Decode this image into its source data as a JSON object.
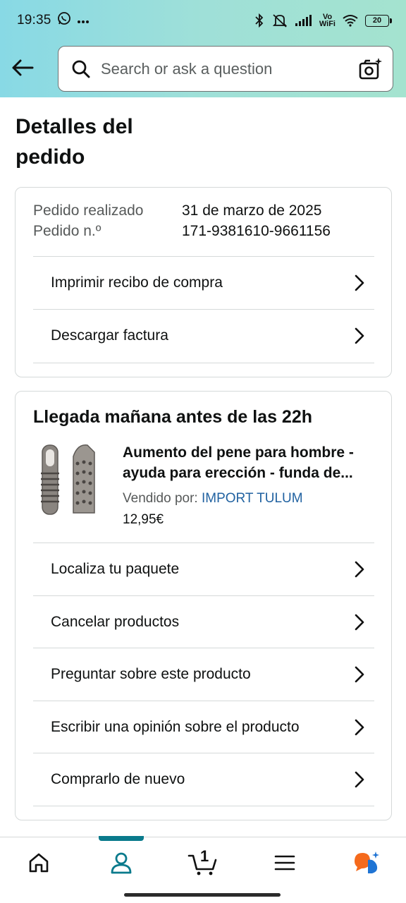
{
  "status_bar": {
    "time": "19:35",
    "left_icons": [
      "whatsapp-icon",
      "more-dots-icon"
    ],
    "right_icons": [
      "bluetooth-icon",
      "mute-icon",
      "signal-icon",
      "vowifi-icon",
      "wifi-icon",
      "battery-icon"
    ],
    "vowifi_label": "Vo\nWiFi",
    "battery_level": "20"
  },
  "header": {
    "back_icon": "arrow-left-icon",
    "search_icon": "search-icon",
    "search_placeholder": "Search or ask a question",
    "camera_icon": "camera-sparkle-icon"
  },
  "page": {
    "title": "Detalles del pedido"
  },
  "order_info": {
    "placed_label": "Pedido realizado",
    "placed_value": "31 de marzo de 2025",
    "number_label": "Pedido n.º",
    "number_value": "171-9381610-9661156",
    "actions": [
      {
        "label": "Imprimir recibo de compra"
      },
      {
        "label": "Descargar factura"
      }
    ]
  },
  "shipment": {
    "heading": "Llegada mañana antes de las 22h",
    "product": {
      "title": "Aumento del pene para hombre - ayuda para erección - funda de...",
      "sold_by_label": "Vendido por:",
      "seller": "IMPORT TULUM",
      "price": "12,95€"
    },
    "actions": [
      {
        "label": "Localiza tu paquete"
      },
      {
        "label": "Cancelar productos"
      },
      {
        "label": "Preguntar sobre este producto"
      },
      {
        "label": "Escribir una opinión sobre el producto"
      },
      {
        "label": "Comprarlo de nuevo"
      }
    ]
  },
  "bottom_nav": {
    "items": [
      "home-icon",
      "account-icon",
      "cart-icon",
      "menu-icon",
      "rufus-ai-icon"
    ],
    "cart_count": "1",
    "active_index": 1
  },
  "colors": {
    "header_gradient_start": "#88d9e5",
    "header_gradient_end": "#a4e3cf",
    "link": "#2162a1",
    "active_tab": "#0a7a8c"
  }
}
